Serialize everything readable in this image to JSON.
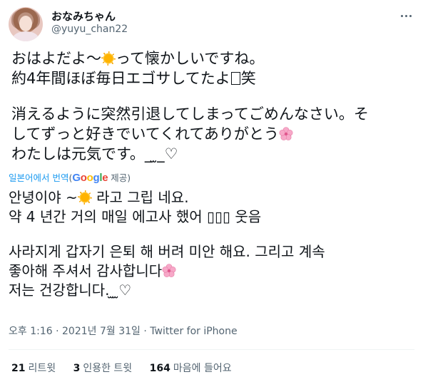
{
  "user": {
    "display_name": "おなみちゃん",
    "handle": "@yuyu_chan22"
  },
  "tweet": {
    "line1_a": "おはよだよ～",
    "line1_b": "って懐かしいですね。",
    "line2_a": "約4年間ほぼ毎日エゴサしてたよ",
    "line2_b": "笑",
    "line3": "消えるように突然引退してしまってごめんなさい。そ",
    "line4": "してずっと好きでいてくれてありがとう",
    "line5": "わたしは元気です。_ ̫_♡"
  },
  "translation": {
    "link_label": "일본어에서 번역",
    "provided_prefix": "(",
    "provider_suffix": " 제공)",
    "line1_a": "안녕이야 ~",
    "line1_b": " 라고 그립 네요.",
    "line2": " 약 4 년간 거의 매일 에고사 했어 ▯▯▯ 웃음",
    "line3": " 사라지게 갑자기 은퇴 해 버려 미안 해요. 그리고 계속",
    "line4": "좋아해 주셔서 감사합니다",
    "line5": " 저는 건강합니다. ̫ ̫♡"
  },
  "meta": {
    "time": "오후 1:16",
    "date": "2021년 7월 31일",
    "source": "Twitter for iPhone",
    "separator": " · "
  },
  "stats": {
    "retweets_count": "21",
    "retweets_label": "리트윗",
    "quotes_count": "3",
    "quotes_label": "인용한 트윗",
    "likes_count": "164",
    "likes_label": "마음에 들어요"
  },
  "icons": {
    "sun": "sun-emoji",
    "blossom": "cherry-blossom-emoji",
    "more": "more-horizontal-icon"
  },
  "colors": {
    "link": "#1d9bf0",
    "secondary_text": "#536471",
    "primary_text": "#0f1419",
    "blossom": "#f7a8c8"
  }
}
